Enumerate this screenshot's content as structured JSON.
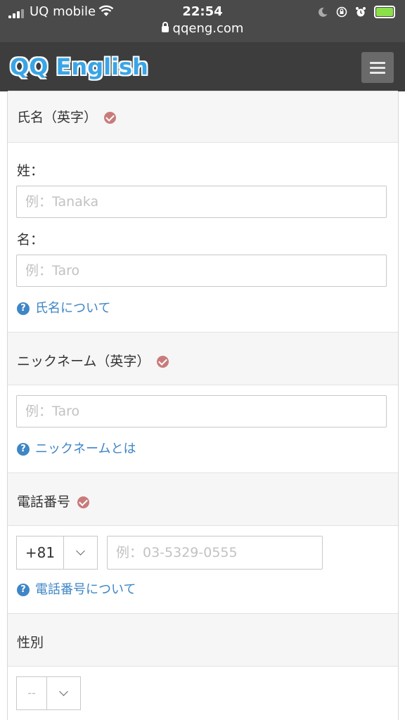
{
  "status_bar": {
    "carrier": "UQ mobile",
    "time": "22:54",
    "url": "qqeng.com"
  },
  "header": {
    "logo": "QQ English"
  },
  "sections": {
    "name": {
      "title": "氏名（英字）",
      "last_label": "姓：",
      "last_placeholder": "例：Tanaka",
      "first_label": "名：",
      "first_placeholder": "例：Taro",
      "help": "氏名について"
    },
    "nickname": {
      "title": "ニックネーム（英字）",
      "placeholder": "例：Taro",
      "help": "ニックネームとは"
    },
    "phone": {
      "title": "電話番号",
      "country_code": "+81",
      "placeholder": "例：03-5329-0555",
      "help": "電話番号について"
    },
    "gender": {
      "title": "性別",
      "value": "--"
    }
  },
  "colors": {
    "required_badge": "#c97b7b",
    "link": "#3f86c6",
    "header_bg": "#3d3d3d",
    "logo": "#3aa5e6"
  },
  "icons": {
    "required": "check-circle-icon",
    "help": "question-circle-icon",
    "menu": "hamburger-icon"
  }
}
